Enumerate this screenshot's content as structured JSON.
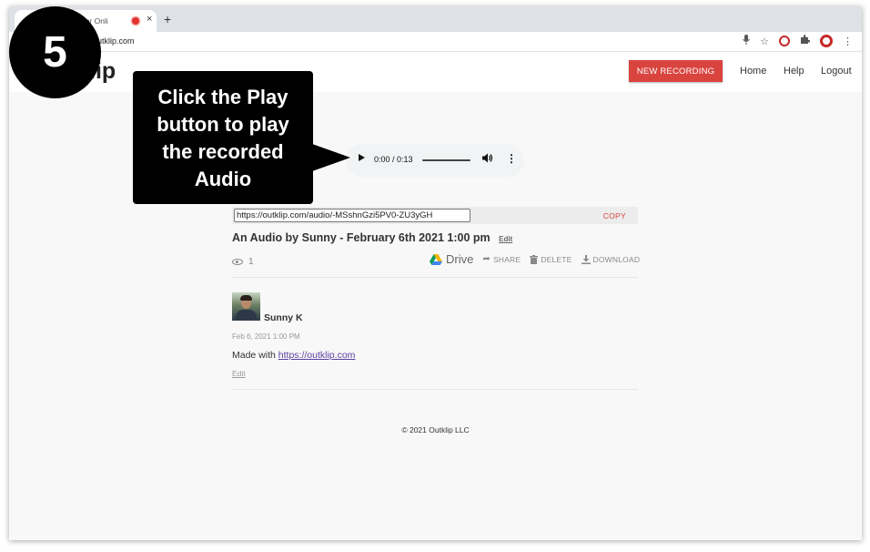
{
  "browser": {
    "tab_title": "os for Onli",
    "tab_close": "×",
    "new_tab": "+",
    "url": "outklip.com"
  },
  "app": {
    "logo": "lip",
    "new_recording_label": "NEW RECORDING",
    "nav": [
      "Home",
      "Help",
      "Logout"
    ],
    "accent_color": "#d9443f"
  },
  "player": {
    "time": "0:00 / 0:13"
  },
  "recording": {
    "link": "https://outklip.com/audio/-MSshnGzi5PV0-ZU3yGH",
    "copy_label": "COPY",
    "title": "An Audio by Sunny - February 6th 2021 1:00 pm",
    "edit_label": "Edit",
    "views": "1",
    "drive_label": "Drive",
    "share_label": "SHARE",
    "delete_label": "DELETE",
    "download_label": "DOWNLOAD"
  },
  "comment": {
    "author": "Sunny K",
    "date": "Feb 6, 2021 1:00 PM",
    "made_with_prefix": "Made with ",
    "made_with_link": "https://outklip.com",
    "edit_label": "Edit"
  },
  "footer": {
    "copyright": "© 2021 Outklip LLC"
  },
  "annotation": {
    "step_number": "5",
    "callout_lines": [
      "Click the Play",
      "button to play",
      "the recorded",
      "Audio"
    ]
  }
}
